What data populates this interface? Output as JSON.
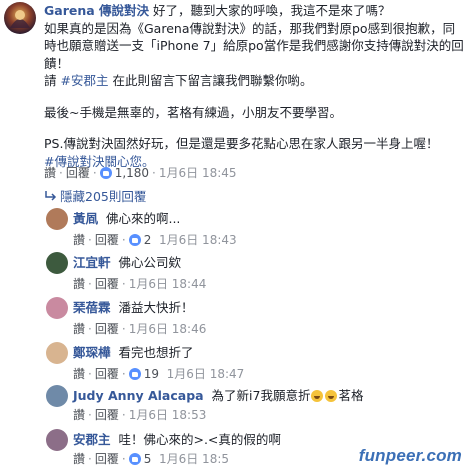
{
  "main_comment": {
    "author": "Garena 傳說對決",
    "line1_rest": " 好了，聽到大家的呼喚，我這不是來了嗎？",
    "para1": "如果真的是因為《Garena傳說對決》的話，那我們對原po感到很抱歉，同時也願意贈送一支「iPhone 7」給原po當作是我們感謝你支持傳說對決的回饋！",
    "para1b_prefix": "請 ",
    "mention": "#安郡主",
    "para1b_suffix": " 在此則留言下留言讓我們聯繫你喲。",
    "para2": "最後~手機是無辜的，茗格有練過，小朋友不要學習。",
    "para3": "PS.傳說對決固然好玩，但是還是要多花點心思在家人跟另一半身上喔！",
    "hashtag": "#傳說對決關心您。",
    "meta": {
      "like": "讚",
      "reply": "回覆",
      "count": "1,180",
      "time": "1月6日 18:45"
    }
  },
  "hidden_replies": "隱藏205則回覆",
  "replies": [
    {
      "author": "黃凮",
      "text": "佛心來的啊...",
      "like": "讚",
      "reply": "回覆",
      "count": "2",
      "time": "1月6日 18:43",
      "avatar_color": "#b07a5a"
    },
    {
      "author": "江宜軒",
      "text": "佛心公司欸",
      "like": "讚",
      "reply": "回覆",
      "count": "",
      "time": "1月6日 18:44",
      "avatar_color": "#3d5a3e"
    },
    {
      "author": "琹蓓霖",
      "text": "潘益大快折！",
      "like": "讚",
      "reply": "回覆",
      "count": "",
      "time": "1月6日 18:46",
      "avatar_color": "#c98aa0"
    },
    {
      "author": "鄭琛樺",
      "text": "看完也想折了",
      "like": "讚",
      "reply": "回覆",
      "count": "19",
      "time": "1月6日 18:47",
      "avatar_color": "#d8b490"
    },
    {
      "author": "Judy Anny Alacapa",
      "text_before": "為了新i7我願意折",
      "text_after": "茗格",
      "like": "讚",
      "reply": "回覆",
      "count": "",
      "time": "1月6日 18:53",
      "avatar_color": "#6f8aa8"
    },
    {
      "author": "安郡主",
      "text": "哇！佛心來的>.<真的假的啊",
      "like": "讚",
      "reply": "回覆",
      "count": "5",
      "time": "1月6日 18:5",
      "avatar_color": "#8c6e88"
    }
  ],
  "watermark": "funpeer.com",
  "colors": {
    "link": "#365899",
    "meta": "#90949c",
    "like_badge": "#5890ff"
  }
}
